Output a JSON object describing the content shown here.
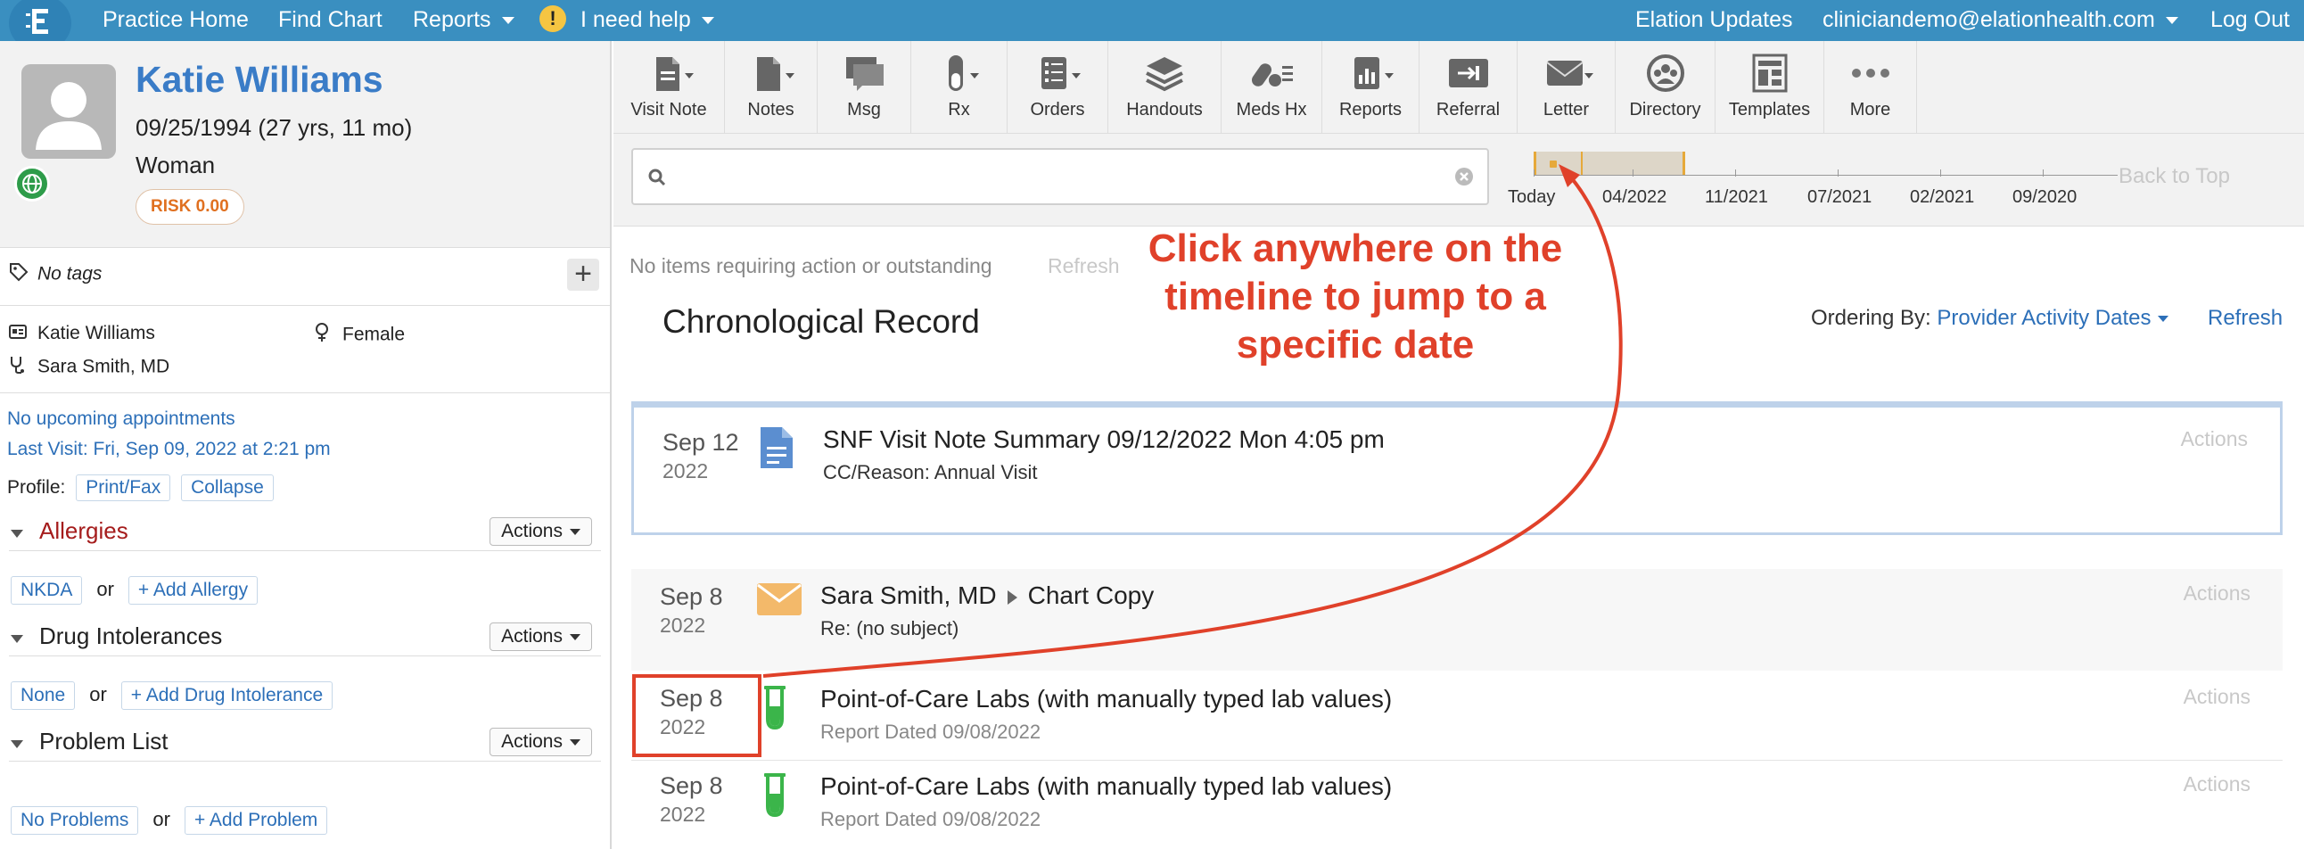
{
  "nav": {
    "items": [
      "Practice Home",
      "Find Chart",
      "Reports"
    ],
    "help_label": "I need help",
    "help_icon": "warning-icon",
    "updates": "Elation Updates",
    "account": "cliniciandemo@elationhealth.com",
    "logout": "Log Out"
  },
  "patient": {
    "name": "Katie Williams",
    "dob": "09/25/1994 (27 yrs, 11 mo)",
    "gender_identity": "Woman",
    "risk": "RISK 0.00",
    "tags": "No tags",
    "display_name": "Katie Williams",
    "sex": "Female",
    "provider": "Sara Smith, MD",
    "appointments": "No upcoming appointments",
    "last_visit": "Last Visit: Fri, Sep 09, 2022 at 2:21 pm",
    "profile_label": "Profile:",
    "print_fax": "Print/Fax",
    "collapse": "Collapse"
  },
  "sections": {
    "actions_label": "Actions",
    "or_label": "or",
    "allergies": {
      "title": "Allergies",
      "chip": "NKDA",
      "add": "+ Add Allergy"
    },
    "intolerances": {
      "title": "Drug Intolerances",
      "chip": "None",
      "add": "+ Add Drug Intolerance"
    },
    "problems": {
      "title": "Problem List",
      "chip": "No Problems",
      "add": "+ Add Problem"
    }
  },
  "toolbar": [
    {
      "label": "Visit Note",
      "icon": "document-icon"
    },
    {
      "label": "Notes",
      "icon": "notes-icon"
    },
    {
      "label": "Msg",
      "icon": "message-icon"
    },
    {
      "label": "Rx",
      "icon": "pill-icon"
    },
    {
      "label": "Orders",
      "icon": "orders-icon"
    },
    {
      "label": "Handouts",
      "icon": "handouts-icon"
    },
    {
      "label": "Meds Hx",
      "icon": "meds-history-icon"
    },
    {
      "label": "Reports",
      "icon": "reports-icon"
    },
    {
      "label": "Referral",
      "icon": "referral-icon"
    },
    {
      "label": "Letter",
      "icon": "letter-icon"
    },
    {
      "label": "Directory",
      "icon": "directory-icon"
    },
    {
      "label": "Templates",
      "icon": "templates-icon"
    },
    {
      "label": "More",
      "icon": "more-icon"
    }
  ],
  "search": {
    "placeholder": ""
  },
  "timeline": {
    "labels": [
      "Today",
      "04/2022",
      "11/2021",
      "07/2021",
      "02/2021",
      "09/2020"
    ],
    "back_to_top": "Back to Top"
  },
  "status": {
    "message": "No items requiring action or outstanding",
    "refresh": "Refresh"
  },
  "record": {
    "title": "Chronological Record",
    "ordering_label": "Ordering By:",
    "ordering_value": "Provider Activity Dates",
    "refresh": "Refresh",
    "actions_label": "Actions",
    "items": [
      {
        "month_day": "Sep 12",
        "year": "2022",
        "icon": "document-icon",
        "title": "SNF Visit Note Summary 09/12/2022 Mon 4:05 pm",
        "subtitle": "CC/Reason: Annual Visit"
      },
      {
        "month_day": "Sep 8",
        "year": "2022",
        "icon": "envelope-icon",
        "from": "Sara Smith, MD",
        "to": "Chart Copy",
        "subtitle": "Re: (no subject)"
      },
      {
        "month_day": "Sep 8",
        "year": "2022",
        "icon": "test-tube-icon",
        "title": "Point-of-Care Labs (with manually typed lab values)",
        "subtitle": "Report Dated 09/08/2022"
      },
      {
        "month_day": "Sep 8",
        "year": "2022",
        "icon": "test-tube-icon",
        "title": "Point-of-Care Labs (with manually typed lab values)",
        "subtitle": "Report Dated 09/08/2022"
      }
    ]
  },
  "annotation": {
    "text": "Click anywhere on the timeline to jump to a specific date",
    "color": "#e0412a"
  },
  "colors": {
    "brand": "#3a8fc0",
    "link": "#2c6fb8",
    "allergy": "#a51c1c",
    "accent": "#e6a93a"
  }
}
